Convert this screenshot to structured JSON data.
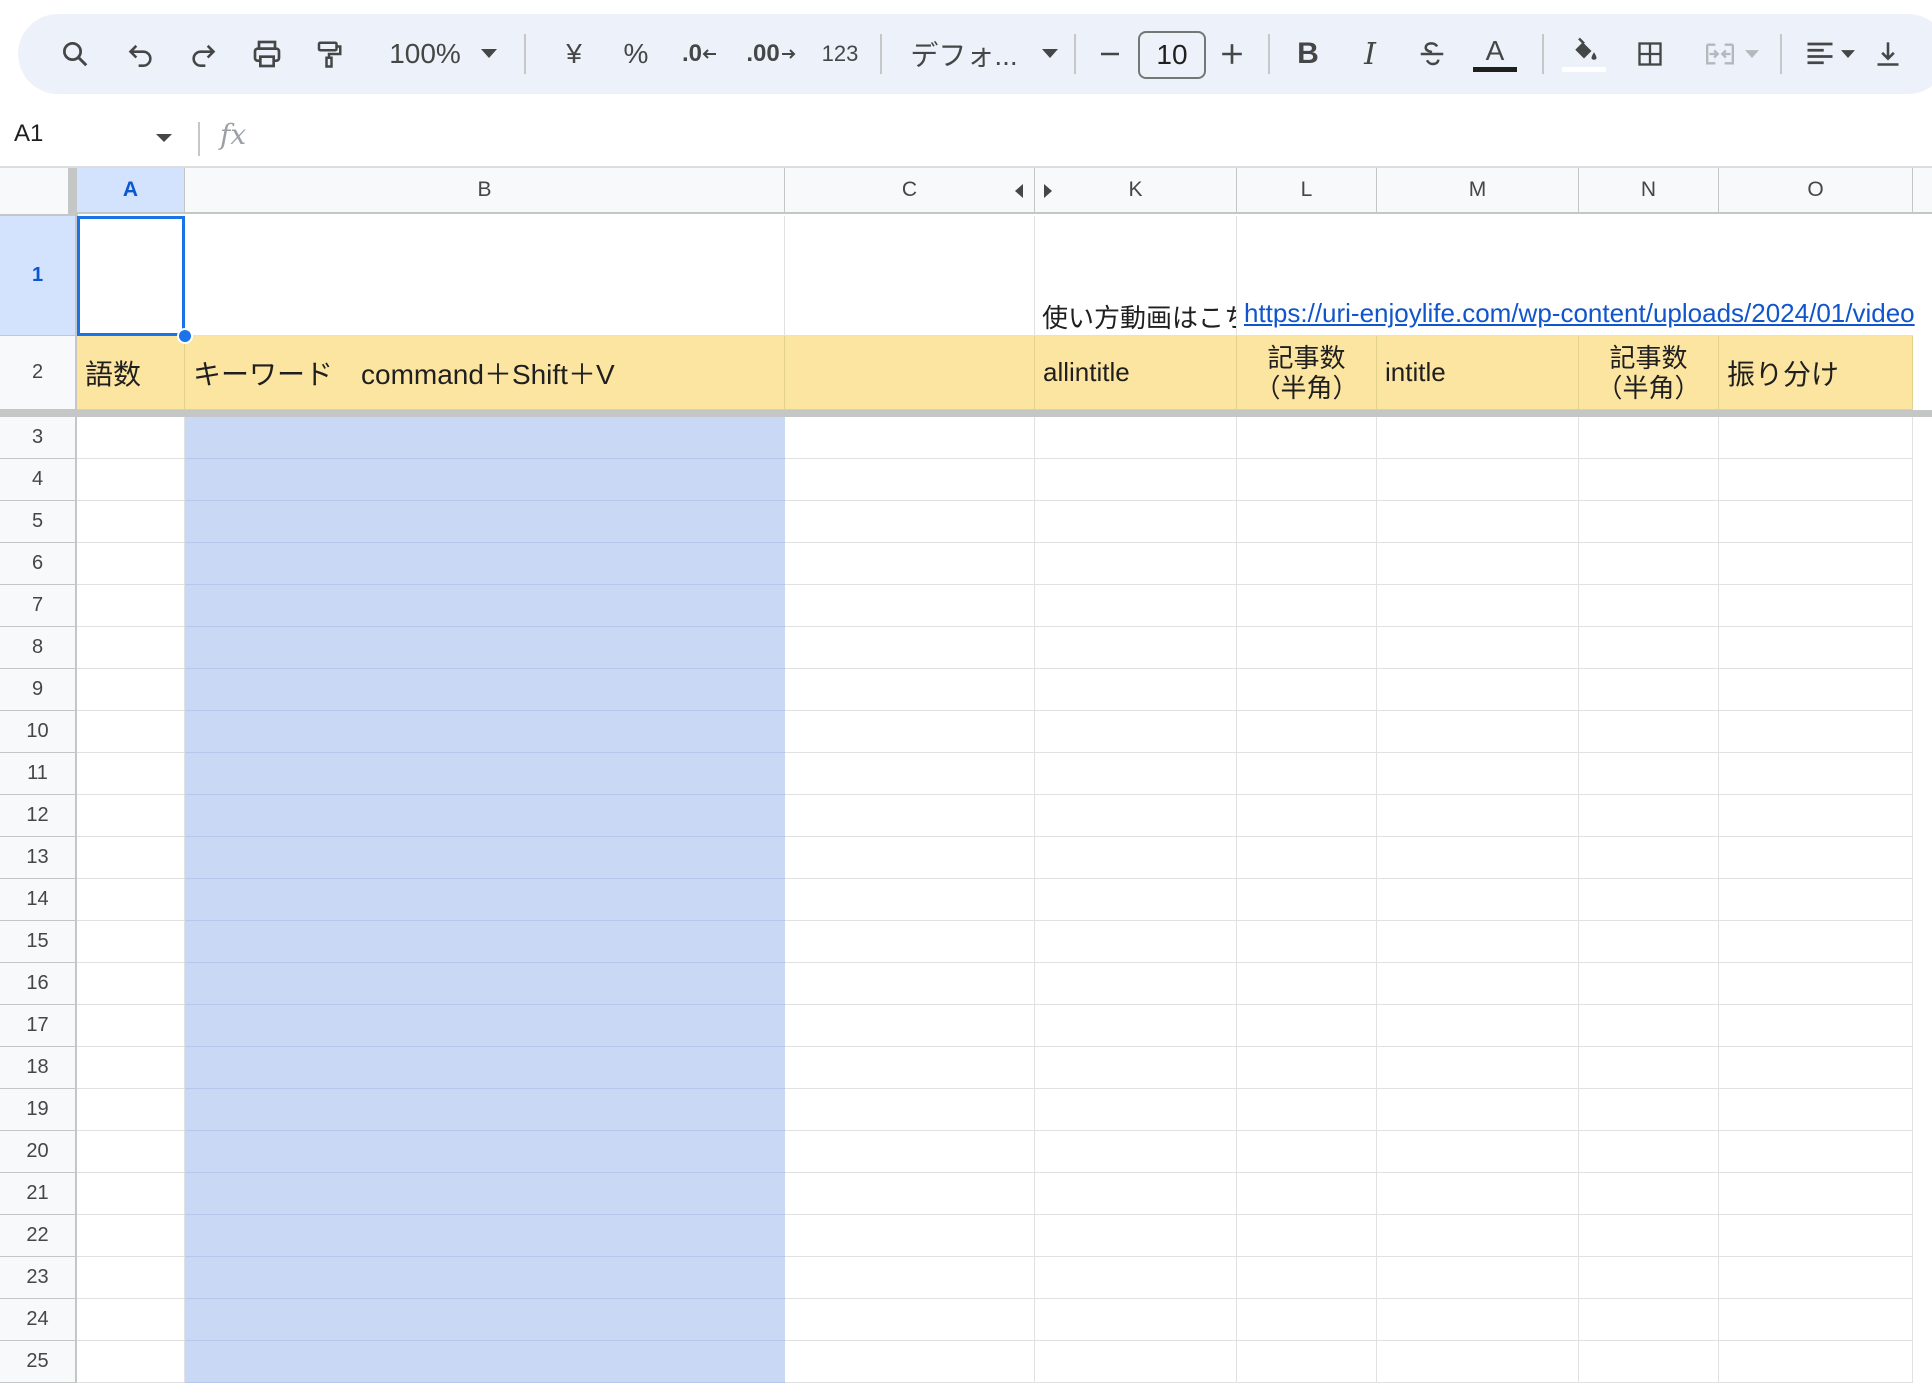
{
  "toolbar": {
    "zoom": "100%",
    "currency": "¥",
    "percent": "%",
    "dec_decrease": ".0",
    "dec_increase": ".00",
    "number_format": "123",
    "font_name": "デフォ...",
    "font_size": "10"
  },
  "formula_bar": {
    "cell_ref": "A1",
    "fx": "fx",
    "content": ""
  },
  "columns": [
    "A",
    "B",
    "C",
    "K",
    "L",
    "M",
    "N",
    "O"
  ],
  "selected_column": "A",
  "rows": [
    "1",
    "2",
    "3",
    "4",
    "5",
    "6",
    "7",
    "8",
    "9",
    "10",
    "11",
    "12",
    "13",
    "14",
    "15",
    "16",
    "17",
    "18",
    "19",
    "20",
    "21",
    "22",
    "23",
    "24",
    "25"
  ],
  "row1": {
    "k_text": "使い方動画はこち",
    "l_link": "https://uri-enjoylife.com/wp-content/uploads/2024/01/video"
  },
  "header_row": {
    "a": "語数",
    "b": "キーワード　command＋Shift＋V",
    "c": "",
    "k": "allintitle",
    "l": "記事数\n（半角）",
    "m": "intitle",
    "n": "記事数\n（半角）",
    "o": "振り分け"
  },
  "colors": {
    "header_fill": "#fce5a0",
    "selection_fill": "#c9d9f5",
    "accent": "#1a73e8",
    "link": "#1155cc"
  }
}
